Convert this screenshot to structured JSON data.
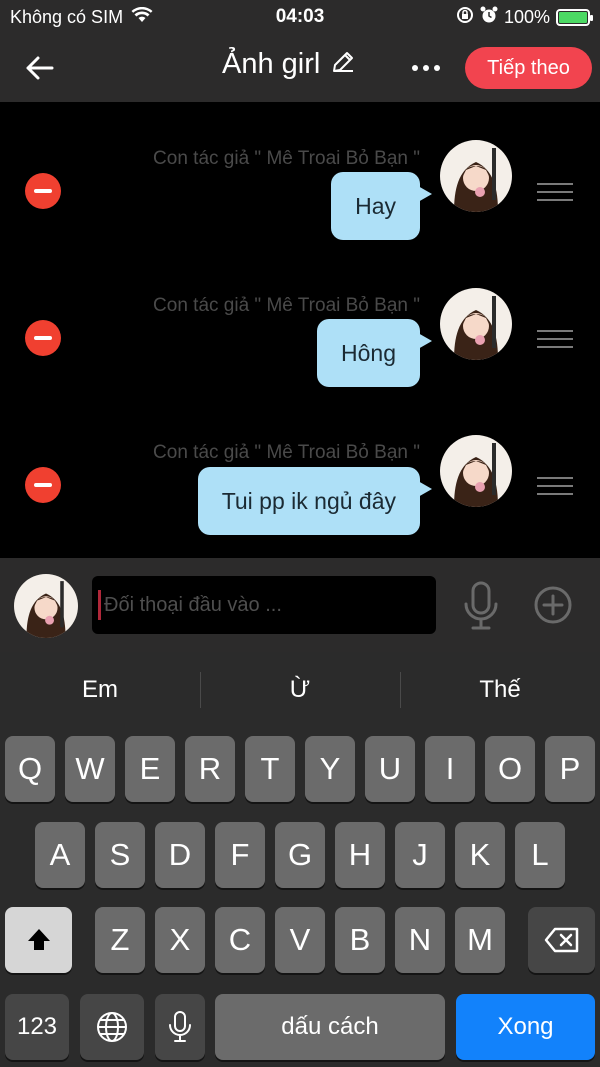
{
  "status_bar": {
    "carrier": "Không có SIM",
    "time": "04:03",
    "battery_pct": "100%",
    "battery_level": 1.0,
    "battery_color": "#4cd964",
    "icons": [
      "wifi-icon",
      "rotation-lock-icon",
      "alarm-icon",
      "charging-icon"
    ]
  },
  "header": {
    "title": "Ảnh girl",
    "next_label": "Tiếp theo",
    "accent": "#f2444f"
  },
  "messages": [
    {
      "author": "Con tác giả \" Mê Troai Bỏ Bạn \"",
      "text": "Hay"
    },
    {
      "author": "Con tác giả \" Mê Troai Bỏ Bạn \"",
      "text": "Hông"
    },
    {
      "author": "Con tác giả \" Mê Troai Bỏ Bạn \"",
      "text": "Tui pp ik ngủ đây"
    }
  ],
  "bubble_color": "#aee0f7",
  "input": {
    "placeholder": "Đối thoại đầu vào ...",
    "value": ""
  },
  "keyboard": {
    "suggestions": [
      "Em",
      "Ừ",
      "Thế"
    ],
    "row1": [
      "Q",
      "W",
      "E",
      "R",
      "T",
      "Y",
      "U",
      "I",
      "O",
      "P"
    ],
    "row2": [
      "A",
      "S",
      "D",
      "F",
      "G",
      "H",
      "J",
      "K",
      "L"
    ],
    "row3": [
      "Z",
      "X",
      "C",
      "V",
      "B",
      "N",
      "M"
    ],
    "numbers_label": "123",
    "space_label": "dấu cách",
    "done_label": "Xong"
  }
}
